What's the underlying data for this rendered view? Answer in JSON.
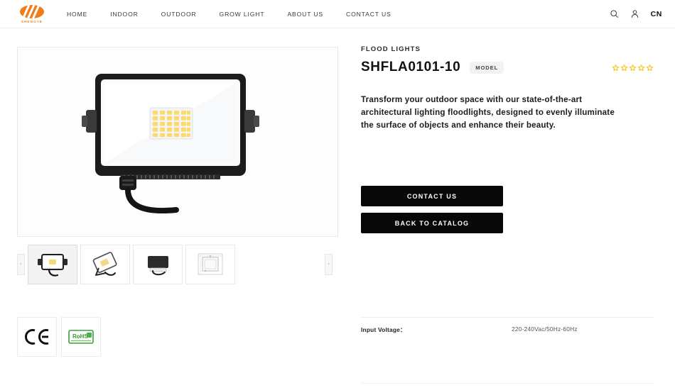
{
  "header": {
    "logo": {
      "icon": "shengye-logo-icon",
      "wordmark": "SHENGYE"
    },
    "nav": [
      {
        "label": "HOME"
      },
      {
        "label": "INDOOR"
      },
      {
        "label": "OUTDOOR"
      },
      {
        "label": "GROW LIGHT"
      },
      {
        "label": "ABOUT US"
      },
      {
        "label": "CONTACT US"
      }
    ],
    "actions": {
      "search_icon": "search-icon",
      "account_icon": "user-icon",
      "language": "CN"
    }
  },
  "gallery": {
    "prev_label": "‹",
    "next_label": "›",
    "main_alt": "LED flood light front view",
    "thumbnails": [
      {
        "alt": "Front view",
        "selected": true
      },
      {
        "alt": "Angled view",
        "selected": false
      },
      {
        "alt": "Back view",
        "selected": false
      },
      {
        "alt": "Dimension drawing",
        "selected": false
      }
    ]
  },
  "certifications": [
    {
      "name": "CE",
      "label": "CE"
    },
    {
      "name": "RoHS",
      "label": "RoHS"
    }
  ],
  "product": {
    "category": "FLOOD LIGHTS",
    "title": "SHFLA0101-10",
    "model_badge": "MODEL",
    "rating": {
      "stars": 5,
      "filled": 0,
      "color": "#f5c518"
    },
    "description": "Transform your outdoor space with our state-of-the-art architectural lighting floodlights, designed to evenly illuminate the surface of objects and enhance their beauty.",
    "buttons": {
      "contact": "CONTACT US",
      "catalog": "BACK TO CATALOG"
    },
    "specs": [
      {
        "label": "Input Voltage：",
        "value": "220-240Vac/50Hz-60Hz"
      }
    ]
  }
}
